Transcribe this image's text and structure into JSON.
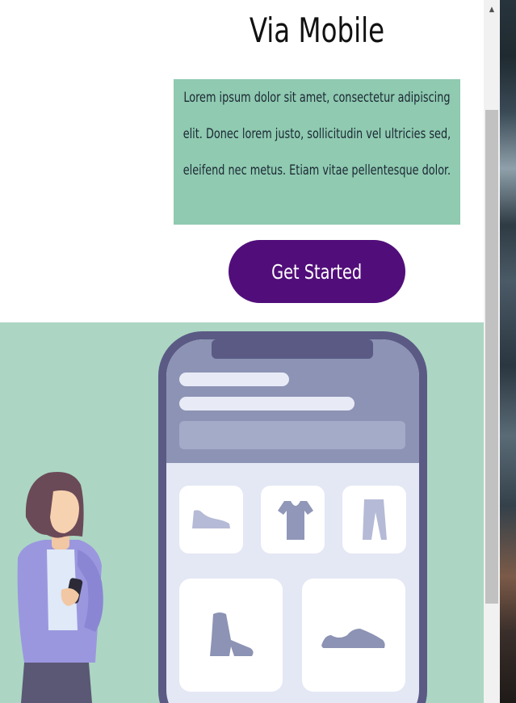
{
  "section": {
    "title": "Via Mobile",
    "description": "Lorem ipsum dolor sit amet, consectetur adipiscing elit. Donec lorem justo, sollicitudin vel ultricies sed, eleifend nec metus. Etiam vitae pellentesque dolor.",
    "cta_label": "Get Started"
  },
  "colors": {
    "description_bg": "#8fcab1",
    "cta_bg": "#510e7a",
    "hero_bg": "#acd6c3",
    "phone_frame": "#5b5a85"
  },
  "illustration": {
    "icons": [
      "sneaker-icon",
      "tshirt-icon",
      "pants-icon",
      "boot-icon",
      "shoe-icon"
    ]
  },
  "scrollbar": {
    "up_arrow": "▲"
  }
}
